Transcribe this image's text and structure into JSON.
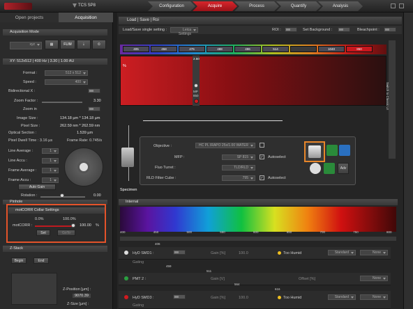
{
  "app": {
    "title": "TCS SP8"
  },
  "workflow": [
    {
      "label": "Configuration",
      "active": false
    },
    {
      "label": "Acquire",
      "active": true
    },
    {
      "label": "Process",
      "active": false
    },
    {
      "label": "Quantify",
      "active": false
    },
    {
      "label": "Analysis",
      "active": false
    }
  ],
  "left_tabs": {
    "open_projects": "Open projects",
    "acquisition": "Acquisition"
  },
  "acq_mode": {
    "title": "Acquisition Mode",
    "mode": "xyz",
    "flim": "FLIM"
  },
  "params": {
    "title": "XY: 512x512 | 400 Hz | 3.30 | 1.00 AU",
    "format_label": "Format :",
    "format_value": "512 x 512",
    "speed_label": "Speed :",
    "speed_value": "400",
    "bidirectional_label": "Bidirectional X :",
    "bidirectional_state": "Off",
    "zoom_factor_label": "Zoom Factor :",
    "zoom_factor_value": "3.30",
    "zoom_in_label": "Zoom in",
    "zoom_in_state": "Off",
    "image_size_label": "Image Size :",
    "image_size_value": "134.18 µm * 134.18 µm",
    "pixel_size_label": "Pixel Size :",
    "pixel_size_value": "262.59 nm * 262.59 nm",
    "optical_section_label": "Optical Section :",
    "optical_section_value": "1.539 µm",
    "pixel_dwell_label": "Pixel Dwell Time : 3.16 µs",
    "frame_rate_label": "Frame Rate: 0.745/s",
    "line_average_label": "Line Average :",
    "line_average_value": "1",
    "line_accu_label": "Line Accu :",
    "line_accu_value": "1",
    "frame_average_label": "Frame Average :",
    "frame_average_value": "1",
    "frame_accu_label": "Frame Accu :",
    "frame_accu_value": "1",
    "auto_gain": "Auto Gain",
    "rotation_label": "Rotation :",
    "rotation_value": "0.00",
    "pinhole_label": "Pinhole"
  },
  "motcorr": {
    "title": "motCORR Collar Settings",
    "min": "0.0%",
    "max": "100.0%",
    "label": "motCORR :",
    "value": "100.00",
    "unit": "%",
    "set": "Set",
    "goto": "GoTo",
    "level": 1.0
  },
  "zstack": {
    "title": "Z-Stack",
    "begin": "Begin",
    "end": "End",
    "z_position_label": "Z-Position [µm] :",
    "z_position_value": "9070.39",
    "z_size_label": "Z-Size [µm] :"
  },
  "main": {
    "title": "Load | Save | Roi",
    "load_save_label": "Load/Save single setting :",
    "leica_settings": "Leica Settings",
    "roi_label": "ROI :",
    "roi_state": "Off",
    "set_background_label": "Set Background :",
    "set_background_state": "Off",
    "bleachpoint_label": "Bleachpoint :",
    "bleachpoint_state": "Off",
    "switch_label": "Switch to Classic UI"
  },
  "lasers": [
    {
      "label": "405",
      "color": "#4a4a55"
    },
    {
      "label": "458",
      "color": "#4a4a55"
    },
    {
      "label": "476",
      "color": "#4a4a55"
    },
    {
      "label": "488",
      "color": "#4a4a55"
    },
    {
      "label": "496",
      "color": "#4a4a55"
    },
    {
      "label": "514",
      "color": "#4a4a55"
    },
    {
      "label": "",
      "color": "#3a3a3a"
    },
    {
      "label": "1040",
      "color": "#4a4a55"
    },
    {
      "label": "850",
      "color": "#c8171d"
    }
  ],
  "laser_panel": {
    "percent_symbol": "%",
    "value": "2.50",
    "mp_label": "MP",
    "mp_value": "850"
  },
  "optics": {
    "objective_label": "Objective :",
    "objective_value": "HC PL IRAPO 25x/1.00 WATER",
    "mfp_label": "MFP :",
    "mfp_value": "SP 815",
    "mfp_autoselect": "Autoselect",
    "fluo_turret_label": "Fluo Turret :",
    "fluo_turret_value": "TLD/RLD",
    "rld_filter_label": "RLD Filter Cube :",
    "rld_filter_value": "795",
    "rld_autoselect": "Autoselect",
    "adv": "Adv",
    "specimen": "Specimen"
  },
  "spectrum": {
    "title": "Internal",
    "ticks": [
      "400",
      "450",
      "500",
      "550",
      "600",
      "650",
      "700",
      "750",
      "800"
    ]
  },
  "detectors": [
    {
      "name": "HyD SMD1 :",
      "state": "Off",
      "gain": "Gain [%]",
      "gain_value": "100.0",
      "mode": "Too Humid",
      "dropdown": "Standard",
      "dropdown2": "None",
      "gating": "Gating",
      "marker_top": "406",
      "marker_bottom": "459"
    },
    {
      "name": "PMT 2 :",
      "state": "Off",
      "gain": "Gain [V]",
      "gain_value": "",
      "mode": "",
      "dropdown": "",
      "dropdown2": "None",
      "offset": "Offset [%]",
      "marker_top": "511",
      "marker_bottom": "564"
    },
    {
      "name": "HyD SMD3 :",
      "state": "Off",
      "gain": "Gain [%]",
      "gain_value": "100.0",
      "mode": "Too Humid",
      "dropdown": "Standard",
      "dropdown2": "None",
      "gating": "Gating",
      "marker_top": "616",
      "marker_bottom": ""
    }
  ]
}
